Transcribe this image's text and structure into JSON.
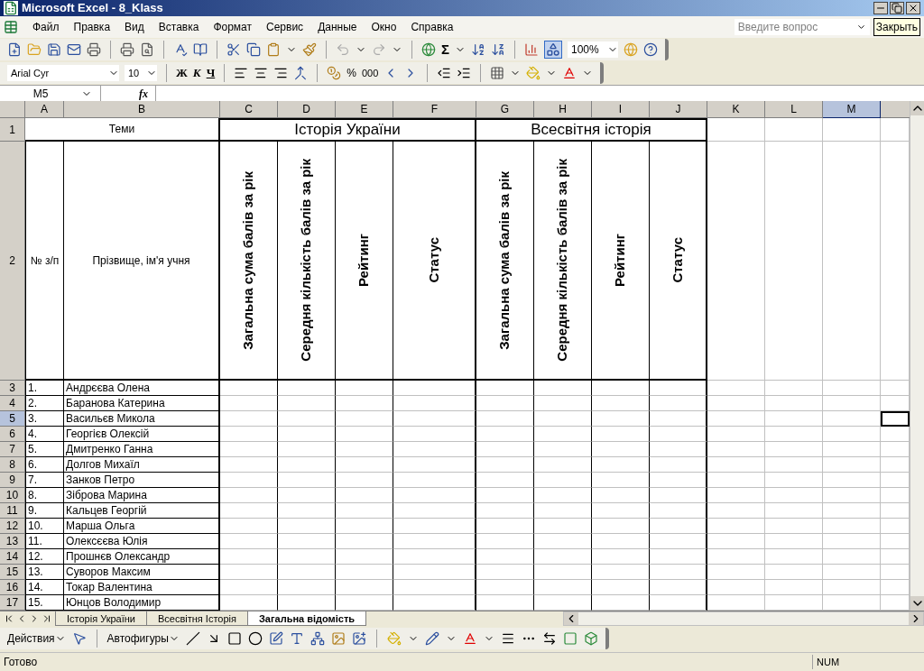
{
  "window": {
    "title": "Microsoft Excel - 8_Klass"
  },
  "menu": [
    "Файл",
    "Правка",
    "Вид",
    "Вставка",
    "Формат",
    "Сервис",
    "Данные",
    "Окно",
    "Справка"
  ],
  "help_search": {
    "placeholder": "Введите вопрос"
  },
  "tooltip": "Закрыть",
  "standard_toolbar": {
    "sigma": "Σ",
    "zoom": "100%"
  },
  "formatting_toolbar": {
    "font": "Arial Cyr",
    "size": "10",
    "bold": "Ж",
    "italic": "К",
    "underline": "Ч",
    "percent": "%",
    "thousands": "000"
  },
  "formula_bar": {
    "name_box": "M5",
    "fx": "fx"
  },
  "sheet": {
    "columns": [
      {
        "label": "A",
        "selected": false
      },
      {
        "label": "B",
        "selected": false
      },
      {
        "label": "C",
        "selected": false
      },
      {
        "label": "D",
        "selected": false
      },
      {
        "label": "E",
        "selected": false
      },
      {
        "label": "F",
        "selected": false
      },
      {
        "label": "G",
        "selected": false
      },
      {
        "label": "H",
        "selected": false
      },
      {
        "label": "I",
        "selected": false
      },
      {
        "label": "J",
        "selected": false
      },
      {
        "label": "K",
        "selected": false
      },
      {
        "label": "L",
        "selected": false
      },
      {
        "label": "M",
        "selected": true
      }
    ],
    "title_row": {
      "row": "1",
      "selected": false,
      "cells": [
        "Теми",
        "Історія України",
        "Всесвітня історія"
      ]
    },
    "header_row": {
      "row": "2",
      "selected": false,
      "cells": [
        "№ з/п",
        "Прізвище, ім'я учня",
        "Загальна сума балів за рік",
        "Середня кількість балів за рік",
        "Рейтинг",
        "Статус",
        "Загальна сума балів за рік",
        "Середня кількість балів за рік",
        "Рейтинг",
        "Статус"
      ]
    },
    "students": [
      {
        "row": "3",
        "selected": false,
        "number": "1.",
        "name": "Андрєєва Олена"
      },
      {
        "row": "4",
        "selected": false,
        "number": "2.",
        "name": "Баранова Катерина"
      },
      {
        "row": "5",
        "selected": true,
        "number": "3.",
        "name": "Васильєв Микола"
      },
      {
        "row": "6",
        "selected": false,
        "number": "4.",
        "name": "Георгієв Олексій"
      },
      {
        "row": "7",
        "selected": false,
        "number": "5.",
        "name": "Дмитренко Ганна"
      },
      {
        "row": "8",
        "selected": false,
        "number": "6.",
        "name": "Долгов Михаїл"
      },
      {
        "row": "9",
        "selected": false,
        "number": "7.",
        "name": "Занков Петро"
      },
      {
        "row": "10",
        "selected": false,
        "number": "8.",
        "name": "Зіброва Марина"
      },
      {
        "row": "11",
        "selected": false,
        "number": "9.",
        "name": "Кальцев Георгій"
      },
      {
        "row": "12",
        "selected": false,
        "number": "10.",
        "name": "Марша Ольга"
      },
      {
        "row": "13",
        "selected": false,
        "number": "11.",
        "name": "Олексєєва Юлія"
      },
      {
        "row": "14",
        "selected": false,
        "number": "12.",
        "name": "Прошнєв Олександр"
      },
      {
        "row": "15",
        "selected": false,
        "number": "13.",
        "name": "Суворов Максим"
      },
      {
        "row": "16",
        "selected": false,
        "number": "14.",
        "name": "Токар Валентина"
      },
      {
        "row": "17",
        "selected": false,
        "number": "15.",
        "name": "Юнцов Володимир"
      }
    ]
  },
  "sheet_tabs": [
    {
      "label": "Історія України",
      "selected": false
    },
    {
      "label": "Всесвітня Історія",
      "selected": false
    },
    {
      "label": "Загальна відомість",
      "selected": true
    }
  ],
  "drawing_toolbar": {
    "actions": "Действия",
    "autoshapes": "Автофигуры"
  },
  "status_bar": {
    "text": "Готово",
    "num": "NUM"
  }
}
